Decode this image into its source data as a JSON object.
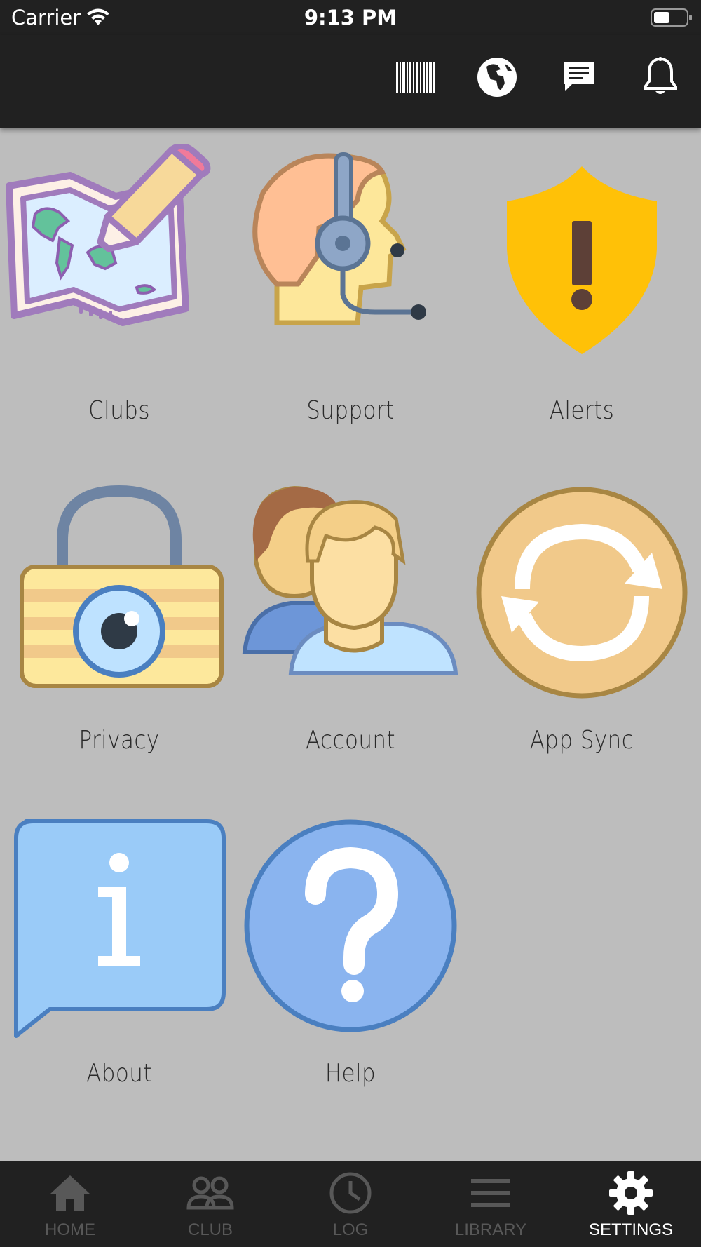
{
  "status_bar": {
    "carrier": "Carrier",
    "time": "9:13 PM"
  },
  "header": {
    "actions": [
      {
        "icon": "barcode-icon"
      },
      {
        "icon": "globe-icon"
      },
      {
        "icon": "message-icon"
      },
      {
        "icon": "bell-icon"
      }
    ]
  },
  "grid": {
    "items": [
      {
        "label": "Clubs",
        "icon": "map-edit-icon"
      },
      {
        "label": "Support",
        "icon": "headset-icon"
      },
      {
        "label": "Alerts",
        "icon": "warning-shield-icon"
      },
      {
        "label": "Privacy",
        "icon": "privacy-lock-icon"
      },
      {
        "label": "Account",
        "icon": "users-icon"
      },
      {
        "label": "App Sync",
        "icon": "sync-icon"
      },
      {
        "label": "About",
        "icon": "info-icon"
      },
      {
        "label": "Help",
        "icon": "help-icon"
      }
    ]
  },
  "tabbar": {
    "tabs": [
      {
        "label": "HOME",
        "icon": "home-icon",
        "active": false
      },
      {
        "label": "CLUB",
        "icon": "club-icon",
        "active": false
      },
      {
        "label": "LOG",
        "icon": "clock-icon",
        "active": false
      },
      {
        "label": "LIBRARY",
        "icon": "library-icon",
        "active": false
      },
      {
        "label": "SETTINGS",
        "icon": "gear-icon",
        "active": true
      }
    ]
  },
  "colors": {
    "bar_background": "#212121",
    "page_background": "#bdbdbd",
    "inactive_tab": "#585858",
    "active_tab": "#ffffff"
  }
}
